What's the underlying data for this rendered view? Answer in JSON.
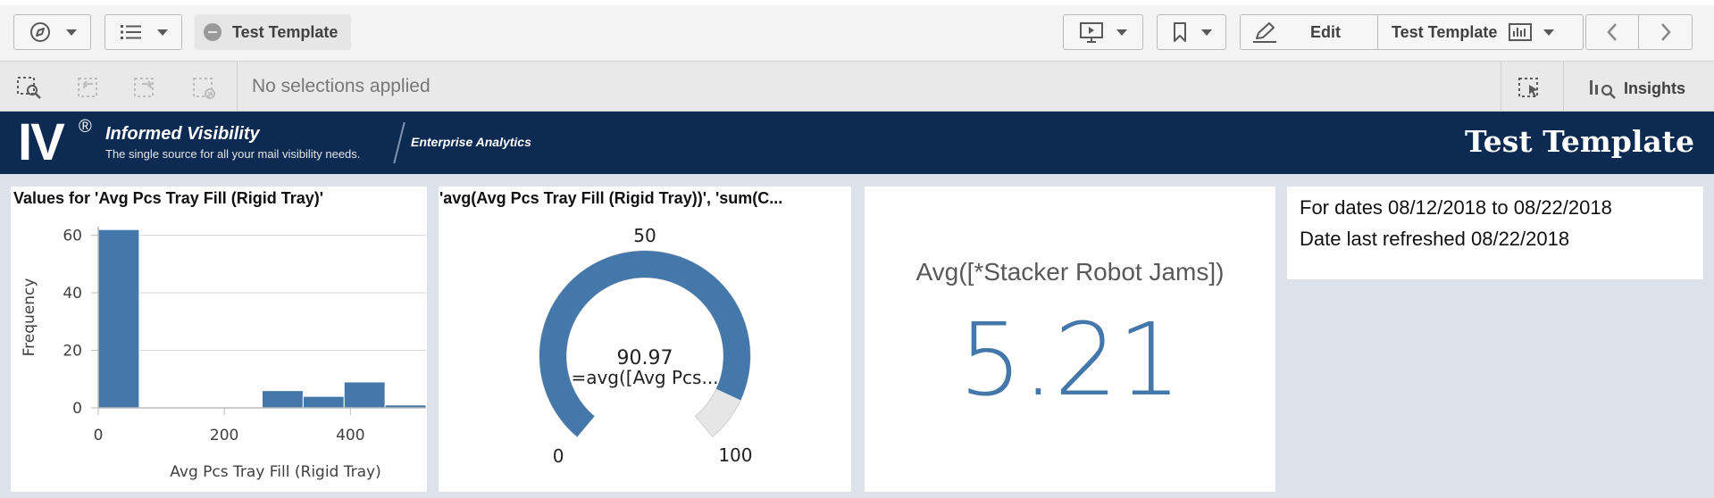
{
  "toolbar": {
    "sheet_name": "Test Template",
    "edit_label": "Edit",
    "app_name": "Test Template"
  },
  "selections": {
    "status": "No selections applied",
    "insights_label": "Insights"
  },
  "banner": {
    "logo": "IV",
    "registered_mark": "®",
    "brand_name": "Informed Visibility",
    "tagline": "The single source for all your mail visibility needs.",
    "section": "Enterprise Analytics",
    "title": "Test Template"
  },
  "histogram": {
    "title": "Values for 'Avg Pcs Tray Fill (Rigid Tray)'",
    "xlabel": "Avg Pcs Tray Fill (Rigid Tray)",
    "ylabel": "Frequency",
    "x_ticks": [
      "0",
      "200",
      "400"
    ],
    "y_ticks": [
      "0",
      "20",
      "40",
      "60"
    ]
  },
  "gauge": {
    "title": "'avg(Avg Pcs Tray Fill (Rigid Tray))', 'sum(C...",
    "value_text": "90.97",
    "expression": "=avg([Avg Pcs...",
    "min_label": "0",
    "mid_label": "50",
    "max_label": "100"
  },
  "kpi": {
    "title": "Avg([*Stacker Robot Jams])",
    "value": "5.21"
  },
  "text_box": {
    "line1": "For dates 08/12/2018 to 08/22/2018",
    "line2": "Date last refreshed 08/22/2018"
  },
  "colors": {
    "accent": "#4477aa",
    "banner": "#0c2a52",
    "gauge_remainder": "#e6e6e6"
  },
  "chart_data": [
    {
      "type": "bar",
      "title": "Values for 'Avg Pcs Tray Fill (Rigid Tray)'",
      "xlabel": "Avg Pcs Tray Fill (Rigid Tray)",
      "ylabel": "Frequency",
      "bins": [
        {
          "from": 0,
          "to": 65,
          "count": 62
        },
        {
          "from": 65,
          "to": 130,
          "count": 0
        },
        {
          "from": 130,
          "to": 195,
          "count": 0
        },
        {
          "from": 195,
          "to": 260,
          "count": 0
        },
        {
          "from": 260,
          "to": 325,
          "count": 6
        },
        {
          "from": 325,
          "to": 390,
          "count": 4
        },
        {
          "from": 390,
          "to": 455,
          "count": 9
        },
        {
          "from": 455,
          "to": 520,
          "count": 1
        }
      ],
      "xlim": [
        0,
        520
      ],
      "ylim": [
        0,
        63
      ],
      "grid": true
    },
    {
      "type": "gauge",
      "title": "'avg(Avg Pcs Tray Fill (Rigid Tray))', 'sum(C...",
      "value": 90.97,
      "min": 0,
      "max": 100,
      "mid": 50
    }
  ]
}
